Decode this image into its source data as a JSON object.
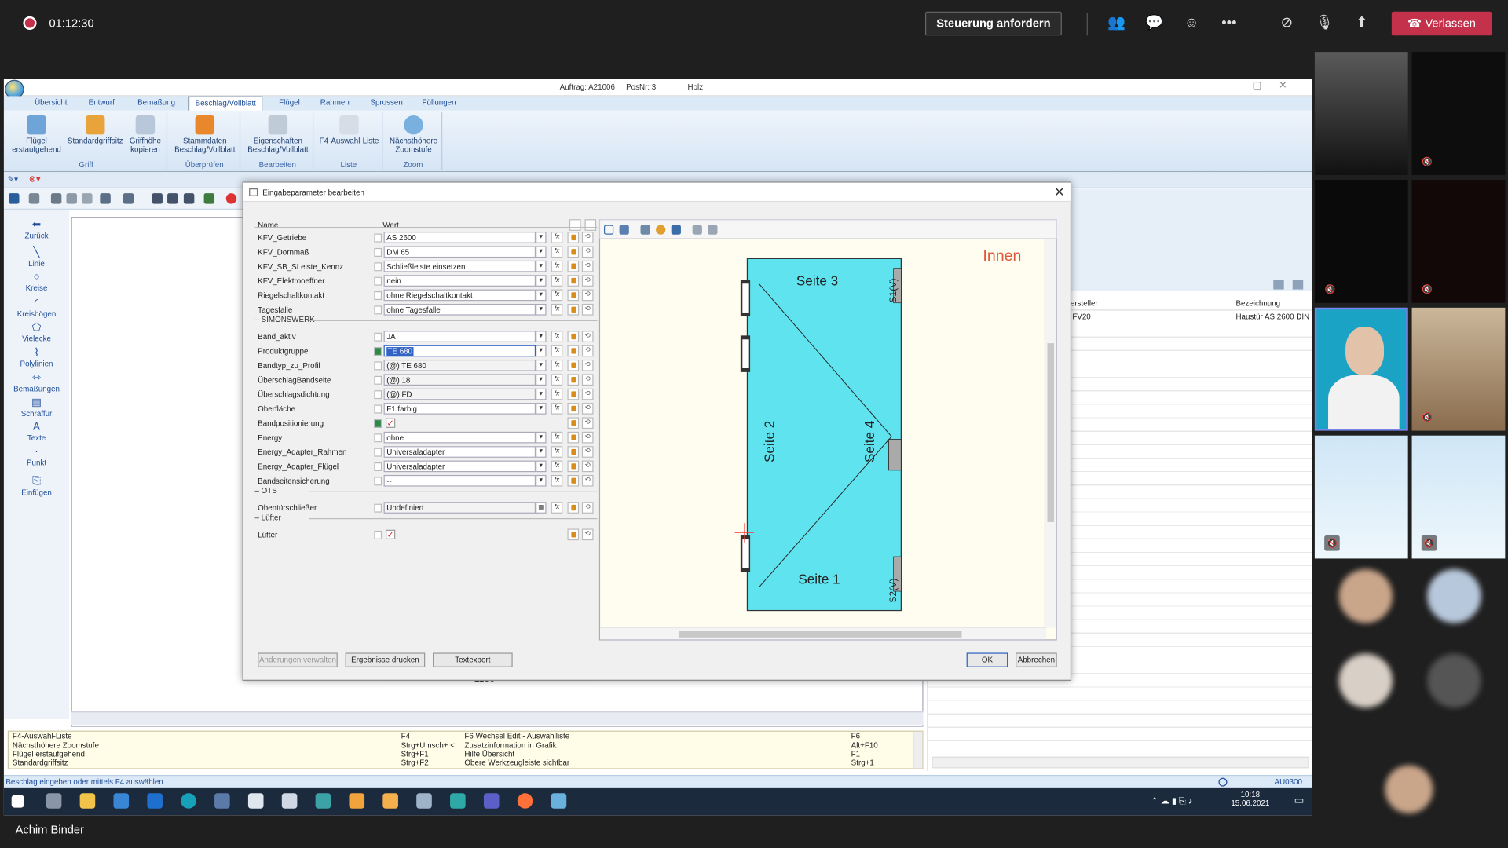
{
  "teams": {
    "timer": "01:12:30",
    "request_control": "Steuerung anfordern",
    "leave": "Verlassen",
    "presenter": "Achim Binder"
  },
  "app": {
    "title_order": "Auftrag: A21006",
    "title_pos": "PosNr: 3",
    "title_material": "Holz",
    "tabs": [
      "Übersicht",
      "Entwurf",
      "Bemaßung",
      "Beschlag/Vollblatt",
      "Flügel",
      "Rahmen",
      "Sprossen",
      "Füllungen"
    ],
    "ribbon_groups": [
      {
        "label": "Griff",
        "buttons": [
          "Flügel erstaufgehend",
          "Standardgriffsitz",
          "Griffhöhe kopieren"
        ]
      },
      {
        "label": "Überprüfen",
        "buttons": [
          "Stammdaten Beschlag/Vollblatt"
        ]
      },
      {
        "label": "Bearbeiten",
        "buttons": [
          "Eigenschaften Beschlag/Vollblatt"
        ]
      },
      {
        "label": "Liste",
        "buttons": [
          "F4-Auswahl-Liste"
        ]
      },
      {
        "label": "Zoom",
        "buttons": [
          "Nächsthöhere Zoomstufe"
        ]
      }
    ],
    "left_tools": [
      "Zurück",
      "Linie",
      "Kreise",
      "Kreisbögen",
      "Vielecke",
      "Polylinien",
      "Bemaßungen",
      "Schraffur",
      "Texte",
      "Punkt",
      "Einfügen"
    ],
    "right_panel": {
      "col1": "ersteller",
      "col2": "Bezeichnung",
      "row_col1": "FV20",
      "row_col2": "Haustür AS 2600 DIN"
    },
    "canvas_label": "1100",
    "shortcuts": [
      {
        "a": "F4-Auswahl-Liste",
        "b": "F4",
        "c": "F6 Wechsel Edit - Auswahlliste",
        "d": "F6"
      },
      {
        "a": "Nächsthöhere Zoomstufe",
        "b": "Strg+Umsch+ <",
        "c": "Zusatzinformation in Grafik",
        "d": "Alt+F10"
      },
      {
        "a": "Flügel erstaufgehend",
        "b": "Strg+F1",
        "c": "Hilfe Übersicht",
        "d": "F1"
      },
      {
        "a": "Standardgriffsitz",
        "b": "Strg+F2",
        "c": "Obere Werkzeugleiste sichtbar",
        "d": "Strg+1"
      }
    ],
    "status": "Beschlag eingeben oder mittels F4 auswählen",
    "status_right": "AU0300",
    "clock_time": "10:18",
    "clock_date": "15.06.2021"
  },
  "dialog": {
    "title": "Eingabeparameter bearbeiten",
    "col_name": "Name",
    "col_value": "Wert",
    "sections": [
      "SIMONSWERK",
      "OTS",
      "Lüfter"
    ],
    "params": [
      {
        "name": "KFV_Getriebe",
        "value": "AS 2600"
      },
      {
        "name": "KFV_Dornmaß",
        "value": "DM 65"
      },
      {
        "name": "KFV_SB_SLeiste_Kennz",
        "value": "Schließleiste einsetzen"
      },
      {
        "name": "KFV_Elektrooeffner",
        "value": "nein"
      },
      {
        "name": "Riegelschaltkontakt",
        "value": "ohne Riegelschaltkontakt"
      },
      {
        "name": "Tagesfalle",
        "value": "ohne Tagesfalle"
      },
      {
        "name": "Band_aktiv",
        "value": "JA"
      },
      {
        "name": "Produktgruppe",
        "value": "TE 680"
      },
      {
        "name": "Bandtyp_zu_Profil",
        "value": "(@) TE 680"
      },
      {
        "name": "ÜberschlagBandseite",
        "value": "(@) 18"
      },
      {
        "name": "Überschlagsdichtung",
        "value": "(@) FD"
      },
      {
        "name": "Oberfläche",
        "value": "F1 farbig"
      },
      {
        "name": "Bandpositionierung",
        "value": ""
      },
      {
        "name": "Energy",
        "value": "ohne"
      },
      {
        "name": "Energy_Adapter_Rahmen",
        "value": "Universaladapter"
      },
      {
        "name": "Energy_Adapter_Flügel",
        "value": "Universaladapter"
      },
      {
        "name": "Bandseitensicherung",
        "value": "--"
      },
      {
        "name": "Obentürschließer",
        "value": "Undefiniert"
      },
      {
        "name": "Lüfter",
        "value": ""
      }
    ],
    "drawing": {
      "innen": "Innen",
      "side1": "Seite  1",
      "side2": "Seite  2",
      "side3": "Seite  3",
      "side4": "Seite  4",
      "s1": "S1(V)",
      "s2": "S2(V)"
    },
    "buttons": {
      "manage": "Änderungen verwalten",
      "print": "Ergebnisse drucken",
      "export": "Textexport",
      "ok": "OK",
      "cancel": "Abbrechen"
    }
  }
}
